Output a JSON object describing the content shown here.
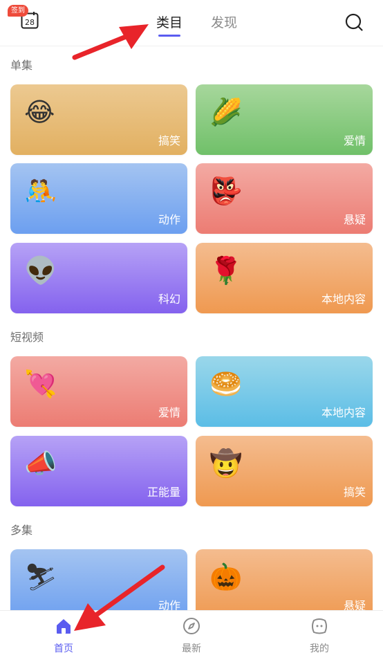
{
  "header": {
    "badge": "签到",
    "calendar_day": "28",
    "tabs": [
      {
        "label": "类目",
        "active": true
      },
      {
        "label": "发现",
        "active": false
      }
    ]
  },
  "sections": [
    {
      "title": "单集",
      "cards": [
        {
          "label": "搞笑",
          "emoji": "😂",
          "color": "tan"
        },
        {
          "label": "爱情",
          "emoji": "🌽",
          "color": "green"
        },
        {
          "label": "动作",
          "emoji": "🤼",
          "color": "blue"
        },
        {
          "label": "悬疑",
          "emoji": "👺",
          "color": "red"
        },
        {
          "label": "科幻",
          "emoji": "👽",
          "color": "purple"
        },
        {
          "label": "本地内容",
          "emoji": "🌹",
          "color": "orange"
        }
      ]
    },
    {
      "title": "短视频",
      "cards": [
        {
          "label": "爱情",
          "emoji": "💘",
          "color": "red"
        },
        {
          "label": "本地内容",
          "emoji": "🥯",
          "color": "cyan"
        },
        {
          "label": "正能量",
          "emoji": "📣",
          "color": "purple"
        },
        {
          "label": "搞笑",
          "emoji": "🤠",
          "color": "orange"
        }
      ]
    },
    {
      "title": "多集",
      "cards": [
        {
          "label": "动作",
          "emoji": "⛷",
          "color": "blue"
        },
        {
          "label": "悬疑",
          "emoji": "🎃",
          "color": "orange"
        }
      ]
    }
  ],
  "bottom_nav": [
    {
      "label": "首页",
      "icon": "home-icon",
      "active": true
    },
    {
      "label": "最新",
      "icon": "compass-icon",
      "active": false
    },
    {
      "label": "我的",
      "icon": "profile-face-icon",
      "active": false
    }
  ],
  "accent_color": "#5a5cf0"
}
